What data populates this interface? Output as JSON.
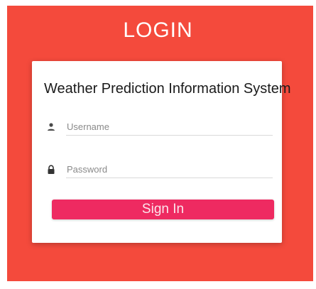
{
  "heading": "LOGIN",
  "form": {
    "title": "Weather Prediction Information System",
    "username": {
      "placeholder": "Username",
      "value": "",
      "icon": "person-icon"
    },
    "password": {
      "placeholder": "Password",
      "value": "",
      "icon": "lock-icon"
    },
    "submit_label": "Sign In"
  },
  "colors": {
    "background": "#f44a3c",
    "card": "#ffffff",
    "button": "#ee2a61"
  }
}
